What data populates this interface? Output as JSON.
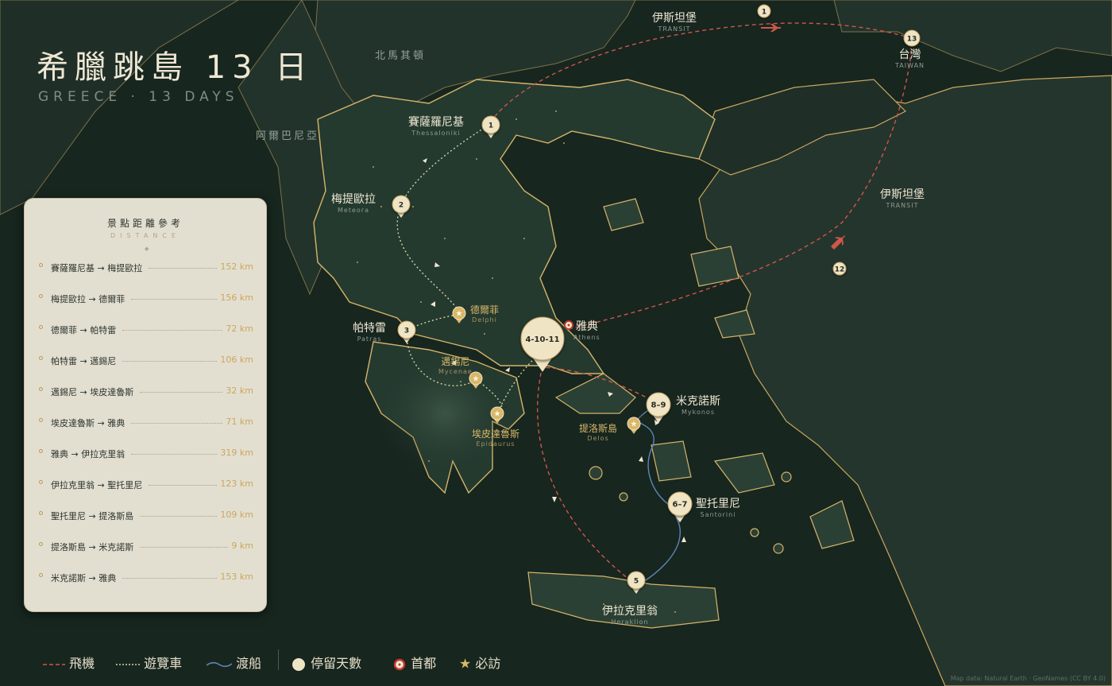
{
  "header": {
    "title": "希臘跳島 13 日",
    "subtitle": "GREECE · 13 DAYS"
  },
  "countries": {
    "north_macedonia": "北馬其頓",
    "albania": "阿爾巴尼亞"
  },
  "places": {
    "thessaloniki": {
      "zh": "賽薩羅尼基",
      "en": "Thessaloniki",
      "day": "1"
    },
    "meteora": {
      "zh": "梅提歐拉",
      "en": "Meteora",
      "day": "2"
    },
    "patras": {
      "zh": "帕特雷",
      "en": "Patras",
      "day": "3"
    },
    "athens": {
      "zh": "雅典",
      "en": "Athens",
      "day": "4-10-11"
    },
    "delphi": {
      "zh": "德爾菲",
      "en": "Delphi",
      "badge": "D3"
    },
    "mycenae": {
      "zh": "邁錫尼",
      "en": "Mycenae",
      "badge": "D4"
    },
    "epidaurus": {
      "zh": "埃皮達魯斯",
      "en": "Epidaurus",
      "badge": "D4"
    },
    "delos": {
      "zh": "提洛斯島",
      "en": "Delos",
      "badge": "D8"
    },
    "mykonos": {
      "zh": "米克諾斯",
      "en": "Mykonos",
      "day": "8–9"
    },
    "santorini": {
      "zh": "聖托里尼",
      "en": "Santorini",
      "day": "6–7"
    },
    "heraklion": {
      "zh": "伊拉克里翁",
      "en": "Heraklion",
      "day": "5"
    },
    "istanbul_top": {
      "zh": "伊斯坦堡",
      "en": "TRANSIT",
      "day": "1"
    },
    "istanbul_right": {
      "zh": "伊斯坦堡",
      "en": "TRANSIT",
      "day": "12"
    },
    "taiwan": {
      "zh": "台灣",
      "en": "TAIWAN",
      "day": "13"
    }
  },
  "distance_panel": {
    "title": "景點距離參考",
    "subtitle": "DISTANCE",
    "rows": [
      {
        "route": "賽薩羅尼基 → 梅提歐拉",
        "km": "152 km"
      },
      {
        "route": "梅提歐拉 → 德爾菲",
        "km": "156 km"
      },
      {
        "route": "德爾菲 → 帕特雷",
        "km": "72 km"
      },
      {
        "route": "帕特雷 → 邁錫尼",
        "km": "106 km"
      },
      {
        "route": "邁錫尼 → 埃皮達魯斯",
        "km": "32 km"
      },
      {
        "route": "埃皮達魯斯 → 雅典",
        "km": "71 km"
      },
      {
        "route": "雅典 → 伊拉克里翁",
        "km": "319 km"
      },
      {
        "route": "伊拉克里翁 → 聖托里尼",
        "km": "123 km"
      },
      {
        "route": "聖托里尼 → 提洛斯島",
        "km": "109 km"
      },
      {
        "route": "提洛斯島 → 米克諾斯",
        "km": "9 km"
      },
      {
        "route": "米克諾斯 → 雅典",
        "km": "153 km"
      }
    ]
  },
  "legend": {
    "flight": "飛機",
    "coach": "遊覽車",
    "ferry": "渡船",
    "stay_days": "停留天數",
    "capital": "首都",
    "must_visit": "必訪"
  },
  "credit": "Map data: Natural Earth · GeoNames (CC BY 4.0)",
  "colors": {
    "sea": "#17261f",
    "land": "#24352d",
    "coast": "#c9a75e",
    "flight": "#d0564b",
    "coach": "#d8d2a4",
    "ferry": "#5f86b6",
    "marker": "#efe4c4"
  }
}
